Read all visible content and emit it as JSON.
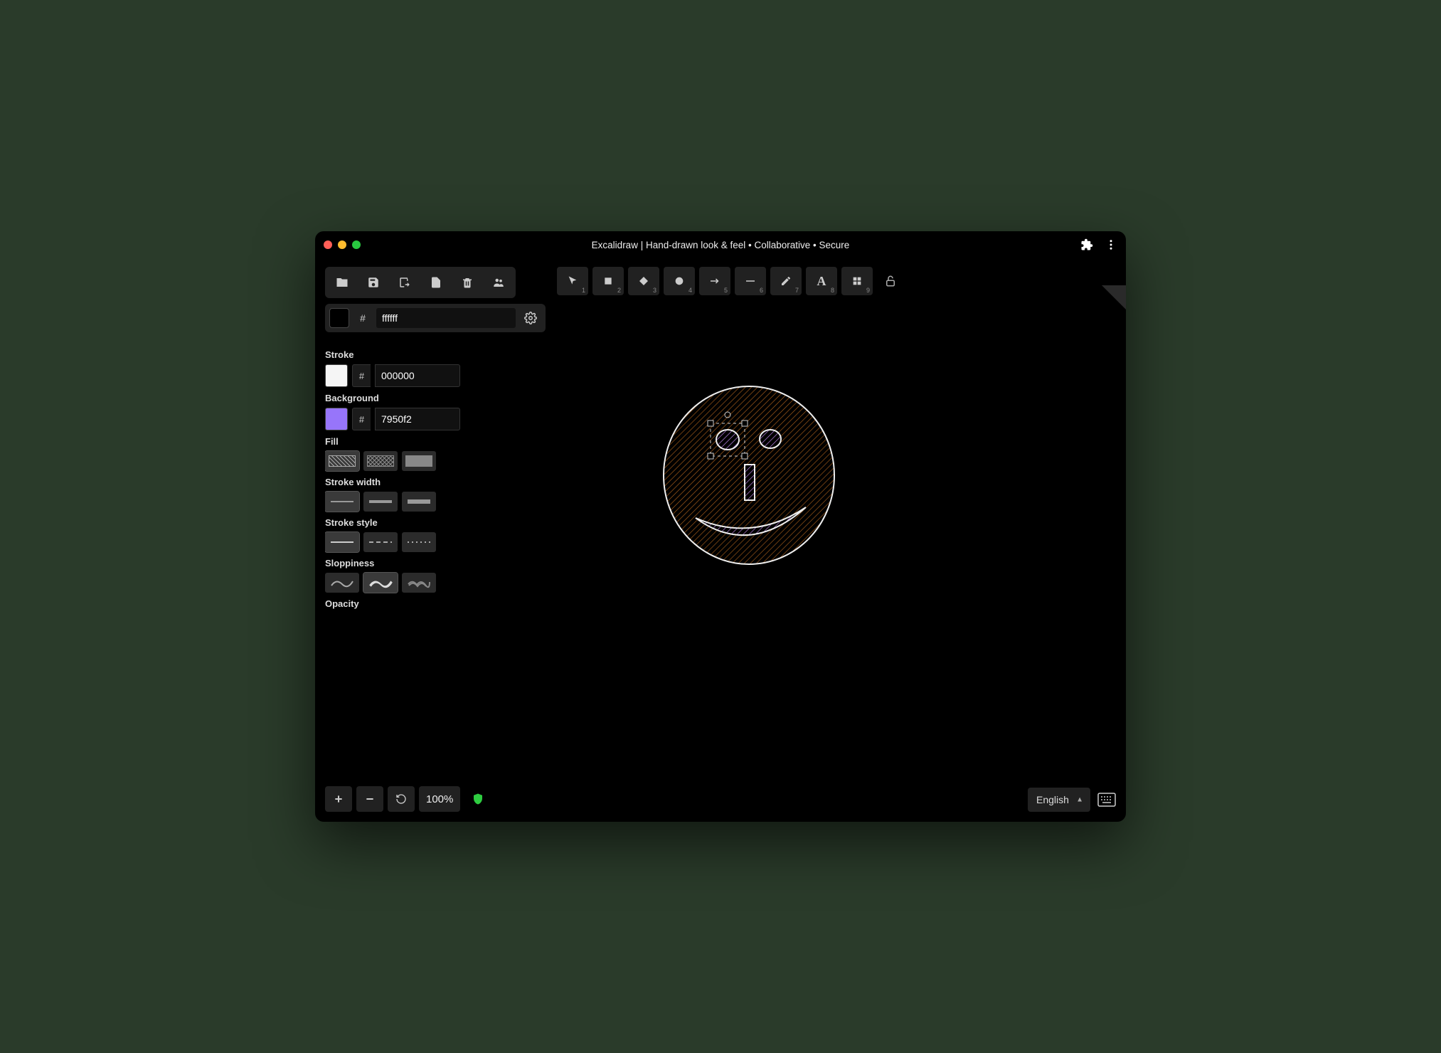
{
  "titlebar": {
    "title": "Excalidraw | Hand-drawn look & feel • Collaborative • Secure"
  },
  "file_toolbar": {
    "open": "open",
    "save": "save",
    "live": "live-collab",
    "export": "export",
    "delete": "delete",
    "collab": "share"
  },
  "canvas_color": {
    "hash": "#",
    "hex": "ffffff"
  },
  "tools": {
    "t1": "1",
    "t2": "2",
    "t3": "3",
    "t4": "4",
    "t5": "5",
    "t6": "6",
    "t7": "7",
    "t8": "8",
    "t9": "9"
  },
  "props": {
    "stroke": {
      "label": "Stroke",
      "hash": "#",
      "hex": "000000",
      "swatch": "#f5f5f5"
    },
    "background": {
      "label": "Background",
      "hash": "#",
      "hex": "7950f2",
      "swatch": "#9775fa"
    },
    "fill": {
      "label": "Fill"
    },
    "stroke_width": {
      "label": "Stroke width"
    },
    "stroke_style": {
      "label": "Stroke style"
    },
    "sloppiness": {
      "label": "Sloppiness"
    },
    "opacity": {
      "label": "Opacity"
    }
  },
  "footer": {
    "zoom": "100%",
    "language": "English"
  }
}
